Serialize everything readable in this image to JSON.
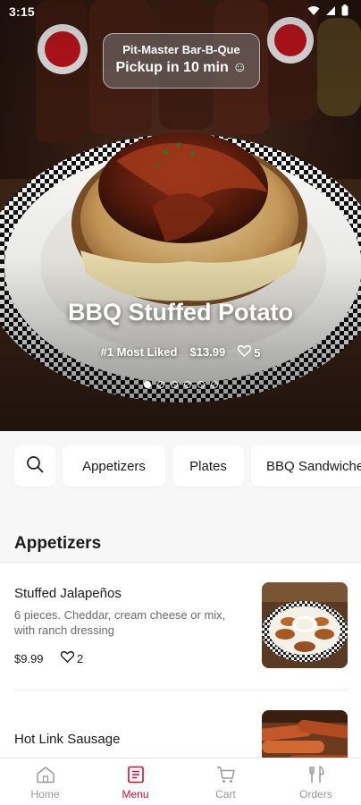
{
  "status_bar": {
    "time": "3:15",
    "icons": [
      "wifi-icon",
      "signal-icon",
      "battery-icon"
    ]
  },
  "restaurant": {
    "name": "Pit-Master Bar-B-Que",
    "pickup": "Pickup in 10 min ☺"
  },
  "featured": {
    "title": "BBQ Stuffed Potato",
    "badge": "#1 Most Liked",
    "price": "$13.99",
    "likes": "5",
    "carousel_pages": 6,
    "active_page": 1
  },
  "categories": {
    "search_icon": "search-icon",
    "items": [
      "Appetizers",
      "Plates",
      "BBQ Sandwiches"
    ]
  },
  "section": {
    "title": "Appetizers"
  },
  "menu_items": [
    {
      "name": "Stuffed Jalapeños",
      "description": "6 pieces. Cheddar, cream cheese or mix, with ranch dressing",
      "price": "$9.99",
      "likes": "2",
      "image": "stuffed-jalapenos-photo"
    },
    {
      "name": "Hot Link Sausage",
      "image": "hot-link-sausage-photo"
    }
  ],
  "bottom_nav": {
    "items": [
      {
        "label": "Home",
        "icon": "home-icon"
      },
      {
        "label": "Menu",
        "icon": "menu-icon"
      },
      {
        "label": "Cart",
        "icon": "cart-icon"
      },
      {
        "label": "Orders",
        "icon": "orders-icon"
      }
    ],
    "active": "Menu"
  },
  "colors": {
    "accent": "#c8102e",
    "inactive": "#9a9a9a",
    "background": "#f7f7f7"
  }
}
